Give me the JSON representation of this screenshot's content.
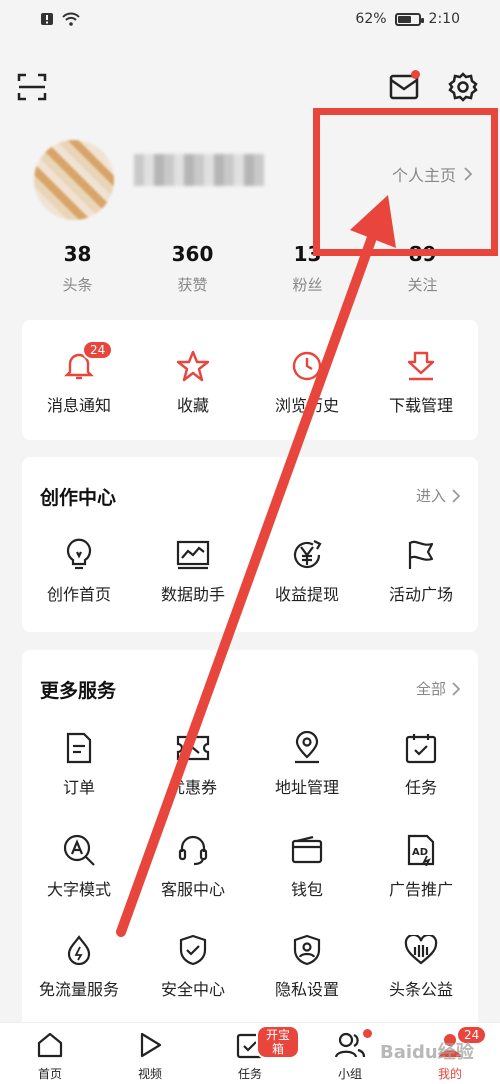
{
  "status_bar": {
    "battery_pct": "62%",
    "time": "2:10",
    "battery_level": 0.62
  },
  "profile": {
    "homepage_link": "个人主页"
  },
  "stats": [
    {
      "value": "38",
      "label": "头条"
    },
    {
      "value": "360",
      "label": "获赞"
    },
    {
      "value": "13",
      "label": "粉丝"
    },
    {
      "value": "89",
      "label": "关注"
    }
  ],
  "quick": {
    "items": [
      {
        "label": "消息通知",
        "icon": "bell-icon",
        "badge": "24"
      },
      {
        "label": "收藏",
        "icon": "star-icon"
      },
      {
        "label": "浏览历史",
        "icon": "clock-icon"
      },
      {
        "label": "下载管理",
        "icon": "download-icon"
      }
    ]
  },
  "creation": {
    "title": "创作中心",
    "link": "进入",
    "items": [
      {
        "label": "创作首页",
        "icon": "lightbulb-icon"
      },
      {
        "label": "数据助手",
        "icon": "chart-icon"
      },
      {
        "label": "收益提现",
        "icon": "yuan-icon"
      },
      {
        "label": "活动广场",
        "icon": "flag-icon"
      }
    ]
  },
  "services": {
    "title": "更多服务",
    "link": "全部",
    "items": [
      {
        "label": "订单",
        "icon": "order-icon"
      },
      {
        "label": "优惠券",
        "icon": "coupon-icon"
      },
      {
        "label": "地址管理",
        "icon": "location-icon"
      },
      {
        "label": "任务",
        "icon": "task-icon"
      },
      {
        "label": "大字模式",
        "icon": "large-font-icon"
      },
      {
        "label": "客服中心",
        "icon": "headset-icon"
      },
      {
        "label": "钱包",
        "icon": "wallet-icon"
      },
      {
        "label": "广告推广",
        "icon": "ad-icon"
      },
      {
        "label": "免流量服务",
        "icon": "data-free-icon"
      },
      {
        "label": "安全中心",
        "icon": "shield-icon"
      },
      {
        "label": "隐私设置",
        "icon": "privacy-icon"
      },
      {
        "label": "头条公益",
        "icon": "charity-icon"
      }
    ]
  },
  "nav": {
    "items": [
      {
        "label": "首页",
        "icon": "home-icon"
      },
      {
        "label": "视频",
        "icon": "play-icon"
      },
      {
        "label": "任务",
        "icon": "task-icon",
        "badge": "开宝箱"
      },
      {
        "label": "小组",
        "icon": "group-icon"
      },
      {
        "label": "我的",
        "icon": "profile-icon",
        "badge": "24",
        "active": true
      }
    ]
  },
  "watermark": "Baidu经验",
  "colors": {
    "accent": "#e8453c",
    "annotation": "#e8453c"
  }
}
